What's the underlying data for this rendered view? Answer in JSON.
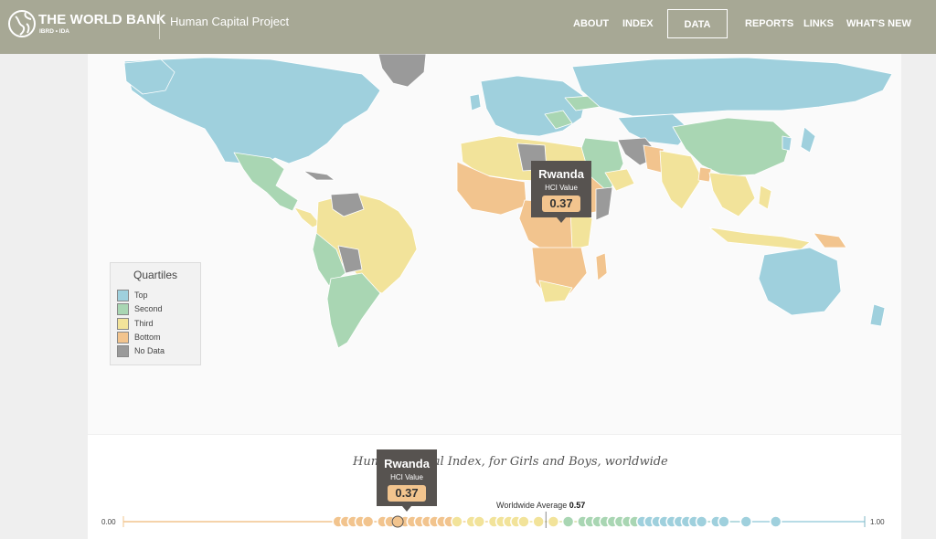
{
  "header": {
    "brand": "THE WORLD BANK",
    "brand_sub": "IBRD • IDA",
    "project": "Human Capital Project",
    "logo_icon": "globe-icon",
    "background": "#a7a895"
  },
  "nav": {
    "about": "ABOUT",
    "index": "INDEX",
    "data": "DATA",
    "reports": "REPORTS",
    "links": "LINKS",
    "whats_new": "WHAT'S NEW",
    "active": "DATA"
  },
  "legend": {
    "title": "Quartiles",
    "items": [
      {
        "label": "Top",
        "color": "#9fd0dd"
      },
      {
        "label": "Second",
        "color": "#a9d6b3"
      },
      {
        "label": "Third",
        "color": "#f2e39a"
      },
      {
        "label": "Bottom",
        "color": "#f2c48e"
      },
      {
        "label": "No Data",
        "color": "#9a9a9a"
      }
    ]
  },
  "map_tooltip": {
    "country": "Rwanda",
    "label": "HCI Value",
    "value": "0.37"
  },
  "chart": {
    "title": "Human Capital Index, for Girls and Boys, worldwide",
    "avg_label": "Worldwide Average",
    "avg_value": "0.57",
    "axis_min": "0.00",
    "axis_max": "1.00",
    "tooltip": {
      "country": "Rwanda",
      "label": "HCI Value",
      "value": "0.37"
    }
  },
  "chart_data": {
    "type": "scatter",
    "title": "Human Capital Index, for Girls and Boys, worldwide",
    "xlabel": "",
    "ylabel": "",
    "xlim": [
      0,
      1
    ],
    "annotations": [
      {
        "text": "Worldwide Average 0.57",
        "x": 0.57
      }
    ],
    "highlight": {
      "name": "Rwanda",
      "x": 0.37
    },
    "x": [
      0.29,
      0.3,
      0.31,
      0.32,
      0.33,
      0.35,
      0.36,
      0.37,
      0.38,
      0.39,
      0.4,
      0.41,
      0.42,
      0.43,
      0.44,
      0.45,
      0.47,
      0.48,
      0.5,
      0.51,
      0.52,
      0.53,
      0.54,
      0.56,
      0.58,
      0.6,
      0.62,
      0.63,
      0.64,
      0.65,
      0.66,
      0.67,
      0.68,
      0.69,
      0.7,
      0.71,
      0.72,
      0.73,
      0.74,
      0.75,
      0.76,
      0.77,
      0.78,
      0.8,
      0.81,
      0.84,
      0.88
    ]
  }
}
